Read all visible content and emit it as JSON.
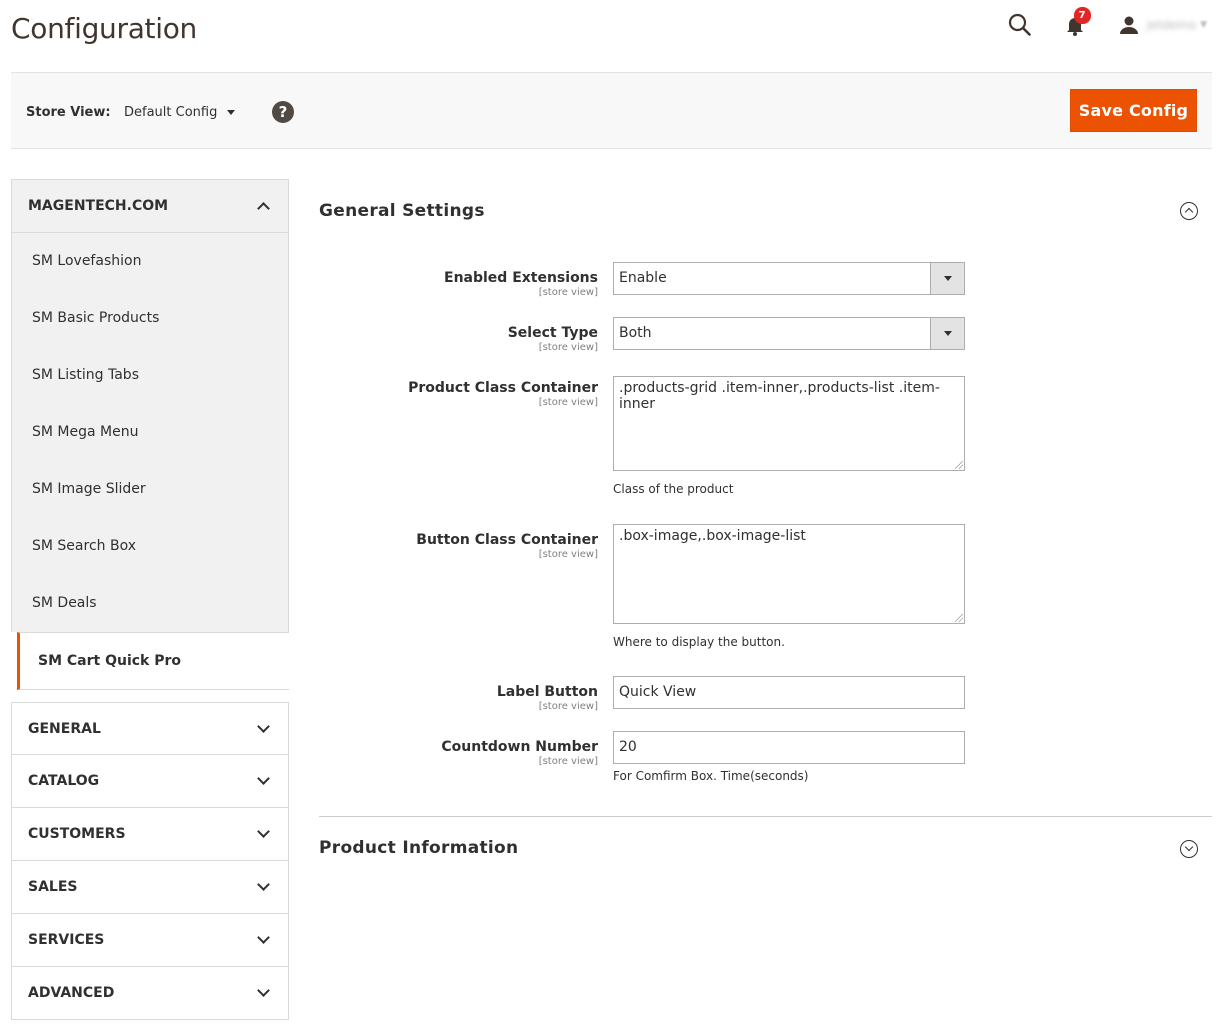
{
  "header": {
    "title": "Configuration",
    "notification_count": "7",
    "user_name": "jetdemo"
  },
  "store_bar": {
    "label": "Store View:",
    "selected": "Default Config",
    "save_label": "Save Config"
  },
  "sidebar": {
    "group_title": "MAGENTECH.COM",
    "items": [
      {
        "label": "SM Lovefashion"
      },
      {
        "label": "SM Basic Products"
      },
      {
        "label": "SM Listing Tabs"
      },
      {
        "label": "SM Mega Menu"
      },
      {
        "label": "SM Image Slider"
      },
      {
        "label": "SM Search Box"
      },
      {
        "label": "SM Deals"
      },
      {
        "label": "SM Cart Quick Pro"
      }
    ],
    "sections": [
      {
        "label": "GENERAL"
      },
      {
        "label": "CATALOG"
      },
      {
        "label": "CUSTOMERS"
      },
      {
        "label": "SALES"
      },
      {
        "label": "SERVICES"
      },
      {
        "label": "ADVANCED"
      }
    ]
  },
  "main": {
    "general_settings_title": "General Settings",
    "product_information_title": "Product Information",
    "scope": "[store view]",
    "fields": {
      "enabled_extensions": {
        "label": "Enabled Extensions",
        "value": "Enable"
      },
      "select_type": {
        "label": "Select Type",
        "value": "Both"
      },
      "product_class_container": {
        "label": "Product Class Container",
        "value": ".products-grid .item-inner,.products-list .item-inner",
        "note": "Class of the product"
      },
      "button_class_container": {
        "label": "Button Class Container",
        "value": ".box-image,.box-image-list",
        "note": "Where to display the button."
      },
      "label_button": {
        "label": "Label Button",
        "value": "Quick View"
      },
      "countdown_number": {
        "label": "Countdown Number",
        "value": "20",
        "note": "For Comfirm Box. Time(seconds)"
      }
    }
  }
}
